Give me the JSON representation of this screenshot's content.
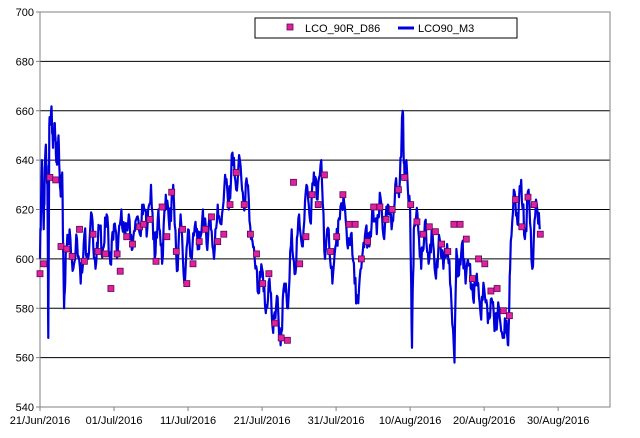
{
  "chart_data": {
    "type": "line",
    "title": "",
    "xlabel": "",
    "ylabel": "",
    "ylim": [
      540,
      700
    ],
    "yticks": [
      540,
      560,
      580,
      600,
      620,
      640,
      660,
      680,
      700
    ],
    "xlim": [
      "2016-06-21",
      "2016-09-06"
    ],
    "xticks": [
      "2016-06-21",
      "2016-07-01",
      "2016-07-11",
      "2016-07-21",
      "2016-07-31",
      "2016-08-10",
      "2016-08-20",
      "2016-08-30"
    ],
    "xtick_labels": [
      "21/Jun/2016",
      "01/Jul/2016",
      "11/Jul/2016",
      "21/Jul/2016",
      "31/Jul/2016",
      "10/Aug/2016",
      "20/Aug/2016",
      "30/Aug/2016"
    ],
    "grid": "horizontal major gridlines",
    "legend_position": "top-center",
    "series": [
      {
        "name": "LCO_90R_D86",
        "kind": "scatter",
        "marker": "square",
        "color": "#e0209e",
        "edge_color": "#5a0a50",
        "points": [
          [
            "2016-06-21 00:00",
            594
          ],
          [
            "2016-06-21 12:00",
            598
          ],
          [
            "2016-06-22 08:00",
            633
          ],
          [
            "2016-06-23 03:00",
            632
          ],
          [
            "2016-06-23 20:00",
            605
          ],
          [
            "2016-06-24 15:00",
            604
          ],
          [
            "2016-06-25 08:00",
            601
          ],
          [
            "2016-06-26 08:00",
            612
          ],
          [
            "2016-06-27 00:00",
            599
          ],
          [
            "2016-06-28 04:00",
            610
          ],
          [
            "2016-06-28 20:00",
            603
          ],
          [
            "2016-06-29 20:00",
            602
          ],
          [
            "2016-06-30 14:00",
            588
          ],
          [
            "2016-07-01 10:00",
            602
          ],
          [
            "2016-07-01 20:00",
            595
          ],
          [
            "2016-07-02 17:00",
            609
          ],
          [
            "2016-07-03 12:00",
            606
          ],
          [
            "2016-07-04 11:00",
            613
          ],
          [
            "2016-07-05 00:00",
            614
          ],
          [
            "2016-07-05 20:00",
            616
          ],
          [
            "2016-07-06 16:00",
            599
          ],
          [
            "2016-07-07 12:00",
            621
          ],
          [
            "2016-07-08 03:00",
            609
          ],
          [
            "2016-07-08 19:00",
            627
          ],
          [
            "2016-07-09 10:00",
            603
          ],
          [
            "2016-07-10 06:00",
            612
          ],
          [
            "2016-07-10 20:00",
            590
          ],
          [
            "2016-07-11 16:00",
            598
          ],
          [
            "2016-07-12 12:00",
            607
          ],
          [
            "2016-07-13 08:00",
            612
          ],
          [
            "2016-07-14 04:00",
            617
          ],
          [
            "2016-07-15 00:00",
            607
          ],
          [
            "2016-07-15 20:00",
            610
          ],
          [
            "2016-07-16 16:00",
            622
          ],
          [
            "2016-07-17 12:00",
            635
          ],
          [
            "2016-07-18 14:00",
            622
          ],
          [
            "2016-07-19 10:00",
            610
          ],
          [
            "2016-07-20 06:00",
            602
          ],
          [
            "2016-07-21 02:00",
            590
          ],
          [
            "2016-07-21 22:00",
            594
          ],
          [
            "2016-07-22 18:00",
            574
          ],
          [
            "2016-07-23 14:00",
            568
          ],
          [
            "2016-07-24 10:00",
            567
          ],
          [
            "2016-07-25 06:00",
            631
          ],
          [
            "2016-07-26 02:00",
            598
          ],
          [
            "2016-07-26 22:00",
            609
          ],
          [
            "2016-07-27 18:00",
            626
          ],
          [
            "2016-07-28 14:00",
            622
          ],
          [
            "2016-07-29 10:00",
            634
          ],
          [
            "2016-07-30 06:00",
            603
          ],
          [
            "2016-07-31 02:00",
            609
          ],
          [
            "2016-07-31 22:00",
            626
          ],
          [
            "2016-08-01 18:00",
            614
          ],
          [
            "2016-08-02 14:00",
            614
          ],
          [
            "2016-08-03 10:00",
            600
          ],
          [
            "2016-08-04 06:00",
            607
          ],
          [
            "2016-08-05 02:00",
            621
          ],
          [
            "2016-08-05 22:00",
            621
          ],
          [
            "2016-08-06 18:00",
            616
          ],
          [
            "2016-08-07 14:00",
            620
          ],
          [
            "2016-08-08 10:00",
            628
          ],
          [
            "2016-08-09 06:00",
            633
          ],
          [
            "2016-08-10 02:00",
            622
          ],
          [
            "2016-08-10 22:00",
            615
          ],
          [
            "2016-08-11 18:00",
            610
          ],
          [
            "2016-08-12 14:00",
            613
          ],
          [
            "2016-08-13 10:00",
            611
          ],
          [
            "2016-08-14 06:00",
            606
          ],
          [
            "2016-08-15 02:00",
            603
          ],
          [
            "2016-08-15 22:00",
            614
          ],
          [
            "2016-08-16 18:00",
            614
          ],
          [
            "2016-08-17 14:00",
            608
          ],
          [
            "2016-08-18 10:00",
            592
          ],
          [
            "2016-08-19 06:00",
            600
          ],
          [
            "2016-08-20 02:00",
            598
          ],
          [
            "2016-08-20 22:00",
            587
          ],
          [
            "2016-08-21 18:00",
            588
          ],
          [
            "2016-08-22 14:00",
            579
          ],
          [
            "2016-08-23 10:00",
            577
          ],
          [
            "2016-08-24 06:00",
            624
          ],
          [
            "2016-08-25 02:00",
            613
          ],
          [
            "2016-08-25 22:00",
            625
          ],
          [
            "2016-08-26 18:00",
            622
          ],
          [
            "2016-08-27 14:00",
            610
          ]
        ]
      },
      {
        "name": "LCO90_M3",
        "kind": "line",
        "color": "#0000dd",
        "anchors": [
          [
            "2016-06-21 00:00",
            600
          ],
          [
            "2016-06-21 06:00",
            640
          ],
          [
            "2016-06-21 12:00",
            612
          ],
          [
            "2016-06-21 18:00",
            645
          ],
          [
            "2016-06-22 00:00",
            630
          ],
          [
            "2016-06-22 03:00",
            568
          ],
          [
            "2016-06-22 06:00",
            654
          ],
          [
            "2016-06-22 12:00",
            660
          ],
          [
            "2016-06-22 18:00",
            645
          ],
          [
            "2016-06-23 00:00",
            655
          ],
          [
            "2016-06-23 06:00",
            640
          ],
          [
            "2016-06-23 12:00",
            650
          ],
          [
            "2016-06-23 18:00",
            628
          ],
          [
            "2016-06-24 00:00",
            635
          ],
          [
            "2016-06-24 06:00",
            580
          ],
          [
            "2016-06-24 12:00",
            605
          ],
          [
            "2016-06-25 00:00",
            612
          ],
          [
            "2016-06-25 12:00",
            596
          ],
          [
            "2016-06-26 00:00",
            608
          ],
          [
            "2016-06-26 12:00",
            590
          ],
          [
            "2016-06-27 00:00",
            610
          ],
          [
            "2016-06-27 12:00",
            600
          ],
          [
            "2016-06-28 00:00",
            618
          ],
          [
            "2016-06-28 12:00",
            596
          ],
          [
            "2016-06-29 00:00",
            612
          ],
          [
            "2016-06-29 12:00",
            604
          ],
          [
            "2016-06-30 00:00",
            618
          ],
          [
            "2016-06-30 12:00",
            598
          ],
          [
            "2016-07-01 00:00",
            614
          ],
          [
            "2016-07-01 12:00",
            602
          ],
          [
            "2016-07-02 00:00",
            620
          ],
          [
            "2016-07-02 12:00",
            608
          ],
          [
            "2016-07-03 00:00",
            618
          ],
          [
            "2016-07-03 12:00",
            604
          ],
          [
            "2016-07-04 00:00",
            616
          ],
          [
            "2016-07-04 12:00",
            610
          ],
          [
            "2016-07-05 00:00",
            622
          ],
          [
            "2016-07-05 12:00",
            612
          ],
          [
            "2016-07-06 00:00",
            630
          ],
          [
            "2016-07-06 12:00",
            600
          ],
          [
            "2016-07-07 00:00",
            620
          ],
          [
            "2016-07-07 12:00",
            598
          ],
          [
            "2016-07-08 00:00",
            626
          ],
          [
            "2016-07-08 12:00",
            612
          ],
          [
            "2016-07-09 00:00",
            630
          ],
          [
            "2016-07-09 12:00",
            595
          ],
          [
            "2016-07-10 00:00",
            618
          ],
          [
            "2016-07-10 12:00",
            590
          ],
          [
            "2016-07-11 00:00",
            612
          ],
          [
            "2016-07-11 12:00",
            600
          ],
          [
            "2016-07-12 00:00",
            615
          ],
          [
            "2016-07-12 12:00",
            604
          ],
          [
            "2016-07-13 00:00",
            620
          ],
          [
            "2016-07-13 12:00",
            606
          ],
          [
            "2016-07-14 00:00",
            618
          ],
          [
            "2016-07-14 12:00",
            600
          ],
          [
            "2016-07-15 00:00",
            622
          ],
          [
            "2016-07-15 12:00",
            614
          ],
          [
            "2016-07-16 00:00",
            634
          ],
          [
            "2016-07-16 12:00",
            620
          ],
          [
            "2016-07-17 00:00",
            643
          ],
          [
            "2016-07-17 12:00",
            628
          ],
          [
            "2016-07-18 00:00",
            640
          ],
          [
            "2016-07-18 12:00",
            622
          ],
          [
            "2016-07-19 00:00",
            630
          ],
          [
            "2016-07-19 12:00",
            608
          ],
          [
            "2016-07-20 00:00",
            600
          ],
          [
            "2016-07-20 12:00",
            586
          ],
          [
            "2016-07-21 00:00",
            596
          ],
          [
            "2016-07-21 12:00",
            578
          ],
          [
            "2016-07-22 00:00",
            592
          ],
          [
            "2016-07-22 12:00",
            570
          ],
          [
            "2016-07-23 00:00",
            585
          ],
          [
            "2016-07-23 12:00",
            565
          ],
          [
            "2016-07-24 00:00",
            590
          ],
          [
            "2016-07-24 12:00",
            580
          ],
          [
            "2016-07-25 00:00",
            612
          ],
          [
            "2016-07-25 12:00",
            594
          ],
          [
            "2016-07-26 00:00",
            618
          ],
          [
            "2016-07-26 12:00",
            605
          ],
          [
            "2016-07-27 00:00",
            630
          ],
          [
            "2016-07-27 12:00",
            615
          ],
          [
            "2016-07-28 00:00",
            635
          ],
          [
            "2016-07-28 12:00",
            624
          ],
          [
            "2016-07-29 00:00",
            640
          ],
          [
            "2016-07-29 12:00",
            600
          ],
          [
            "2016-07-30 00:00",
            612
          ],
          [
            "2016-07-30 12:00",
            590
          ],
          [
            "2016-07-31 00:00",
            606
          ],
          [
            "2016-07-31 12:00",
            616
          ],
          [
            "2016-08-01 00:00",
            626
          ],
          [
            "2016-08-01 12:00",
            606
          ],
          [
            "2016-08-02 00:00",
            610
          ],
          [
            "2016-08-02 12:00",
            590
          ],
          [
            "2016-08-03 00:00",
            582
          ],
          [
            "2016-08-03 12:00",
            600
          ],
          [
            "2016-08-04 00:00",
            612
          ],
          [
            "2016-08-04 12:00",
            605
          ],
          [
            "2016-08-05 00:00",
            620
          ],
          [
            "2016-08-05 12:00",
            610
          ],
          [
            "2016-08-06 00:00",
            625
          ],
          [
            "2016-08-06 12:00",
            608
          ],
          [
            "2016-08-07 00:00",
            622
          ],
          [
            "2016-08-07 12:00",
            612
          ],
          [
            "2016-08-08 00:00",
            630
          ],
          [
            "2016-08-08 12:00",
            625
          ],
          [
            "2016-08-09 00:00",
            660
          ],
          [
            "2016-08-09 06:00",
            632
          ],
          [
            "2016-08-09 12:00",
            640
          ],
          [
            "2016-08-10 00:00",
            620
          ],
          [
            "2016-08-10 06:00",
            564
          ],
          [
            "2016-08-10 12:00",
            612
          ],
          [
            "2016-08-11 00:00",
            618
          ],
          [
            "2016-08-11 12:00",
            596
          ],
          [
            "2016-08-12 00:00",
            615
          ],
          [
            "2016-08-12 12:00",
            598
          ],
          [
            "2016-08-13 00:00",
            612
          ],
          [
            "2016-08-13 12:00",
            592
          ],
          [
            "2016-08-14 00:00",
            608
          ],
          [
            "2016-08-14 12:00",
            596
          ],
          [
            "2016-08-15 00:00",
            606
          ],
          [
            "2016-08-15 12:00",
            588
          ],
          [
            "2016-08-16 00:00",
            558
          ],
          [
            "2016-08-16 06:00",
            604
          ],
          [
            "2016-08-16 12:00",
            596
          ],
          [
            "2016-08-17 00:00",
            606
          ],
          [
            "2016-08-17 12:00",
            590
          ],
          [
            "2016-08-18 00:00",
            598
          ],
          [
            "2016-08-18 12:00",
            584
          ],
          [
            "2016-08-19 00:00",
            594
          ],
          [
            "2016-08-19 12:00",
            578
          ],
          [
            "2016-08-20 00:00",
            588
          ],
          [
            "2016-08-20 12:00",
            574
          ],
          [
            "2016-08-21 00:00",
            584
          ],
          [
            "2016-08-21 12:00",
            572
          ],
          [
            "2016-08-22 00:00",
            580
          ],
          [
            "2016-08-22 12:00",
            568
          ],
          [
            "2016-08-23 00:00",
            575
          ],
          [
            "2016-08-23 06:00",
            565
          ],
          [
            "2016-08-23 12:00",
            596
          ],
          [
            "2016-08-24 00:00",
            628
          ],
          [
            "2016-08-24 12:00",
            614
          ],
          [
            "2016-08-25 00:00",
            632
          ],
          [
            "2016-08-25 12:00",
            608
          ],
          [
            "2016-08-26 00:00",
            628
          ],
          [
            "2016-08-26 12:00",
            596
          ],
          [
            "2016-08-27 00:00",
            624
          ],
          [
            "2016-08-27 12:00",
            612
          ]
        ]
      }
    ]
  }
}
